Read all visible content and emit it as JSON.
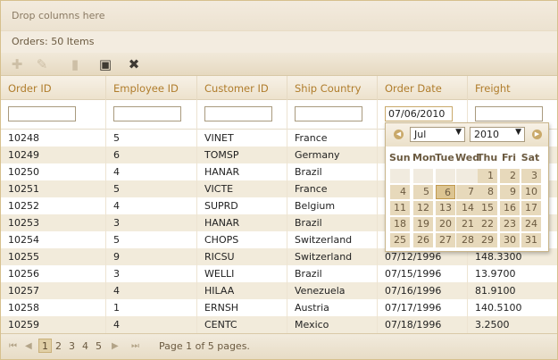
{
  "group_panel": {
    "text": "Drop columns here"
  },
  "caption": {
    "text": "Orders: 50 Items"
  },
  "toolbar": {
    "buttons": [
      {
        "name": "add",
        "icon": "plus-icon",
        "glyph": "✚",
        "enabled": false
      },
      {
        "name": "edit",
        "icon": "pencil-icon",
        "glyph": "✎",
        "enabled": false
      },
      {
        "name": "delete",
        "icon": "trash-icon",
        "glyph": "▮",
        "enabled": false
      },
      {
        "name": "save",
        "icon": "save-icon",
        "glyph": "▣",
        "enabled": true
      },
      {
        "name": "cancel",
        "icon": "cancel-icon",
        "glyph": "✖",
        "enabled": true
      }
    ]
  },
  "columns": [
    "Order ID",
    "Employee ID",
    "Customer ID",
    "Ship Country",
    "Order Date",
    "Freight"
  ],
  "filters": [
    "",
    "",
    "",
    "",
    "07/06/2010",
    ""
  ],
  "rows": [
    [
      "10248",
      "5",
      "VINET",
      "France",
      "",
      ""
    ],
    [
      "10249",
      "6",
      "TOMSP",
      "Germany",
      "",
      ""
    ],
    [
      "10250",
      "4",
      "HANAR",
      "Brazil",
      "",
      ""
    ],
    [
      "10251",
      "5",
      "VICTE",
      "France",
      "",
      ""
    ],
    [
      "10252",
      "4",
      "SUPRD",
      "Belgium",
      "",
      ""
    ],
    [
      "10253",
      "3",
      "HANAR",
      "Brazil",
      "",
      ""
    ],
    [
      "10254",
      "5",
      "CHOPS",
      "Switzerland",
      "",
      ""
    ],
    [
      "10255",
      "9",
      "RICSU",
      "Switzerland",
      "07/12/1996",
      "148.3300"
    ],
    [
      "10256",
      "3",
      "WELLI",
      "Brazil",
      "07/15/1996",
      "13.9700"
    ],
    [
      "10257",
      "4",
      "HILAA",
      "Venezuela",
      "07/16/1996",
      "81.9100"
    ],
    [
      "10258",
      "1",
      "ERNSH",
      "Austria",
      "07/17/1996",
      "140.5100"
    ],
    [
      "10259",
      "4",
      "CENTC",
      "Mexico",
      "07/18/1996",
      "3.2500"
    ]
  ],
  "calendar": {
    "month": "Jul",
    "year": "2010",
    "weekdays": [
      "Sun",
      "Mon",
      "Tue",
      "Wed",
      "Thu",
      "Fri",
      "Sat"
    ],
    "selected_day": "6",
    "weeks": [
      [
        "",
        "",
        "",
        "",
        "1",
        "2",
        "3"
      ],
      [
        "4",
        "5",
        "6",
        "7",
        "8",
        "9",
        "10"
      ],
      [
        "11",
        "12",
        "13",
        "14",
        "15",
        "16",
        "17"
      ],
      [
        "18",
        "19",
        "20",
        "21",
        "22",
        "23",
        "24"
      ],
      [
        "25",
        "26",
        "27",
        "28",
        "29",
        "30",
        "31"
      ]
    ]
  },
  "pager": {
    "pages": [
      "1",
      "2",
      "3",
      "4",
      "5"
    ],
    "current": "1",
    "info": "Page 1 of 5 pages."
  }
}
